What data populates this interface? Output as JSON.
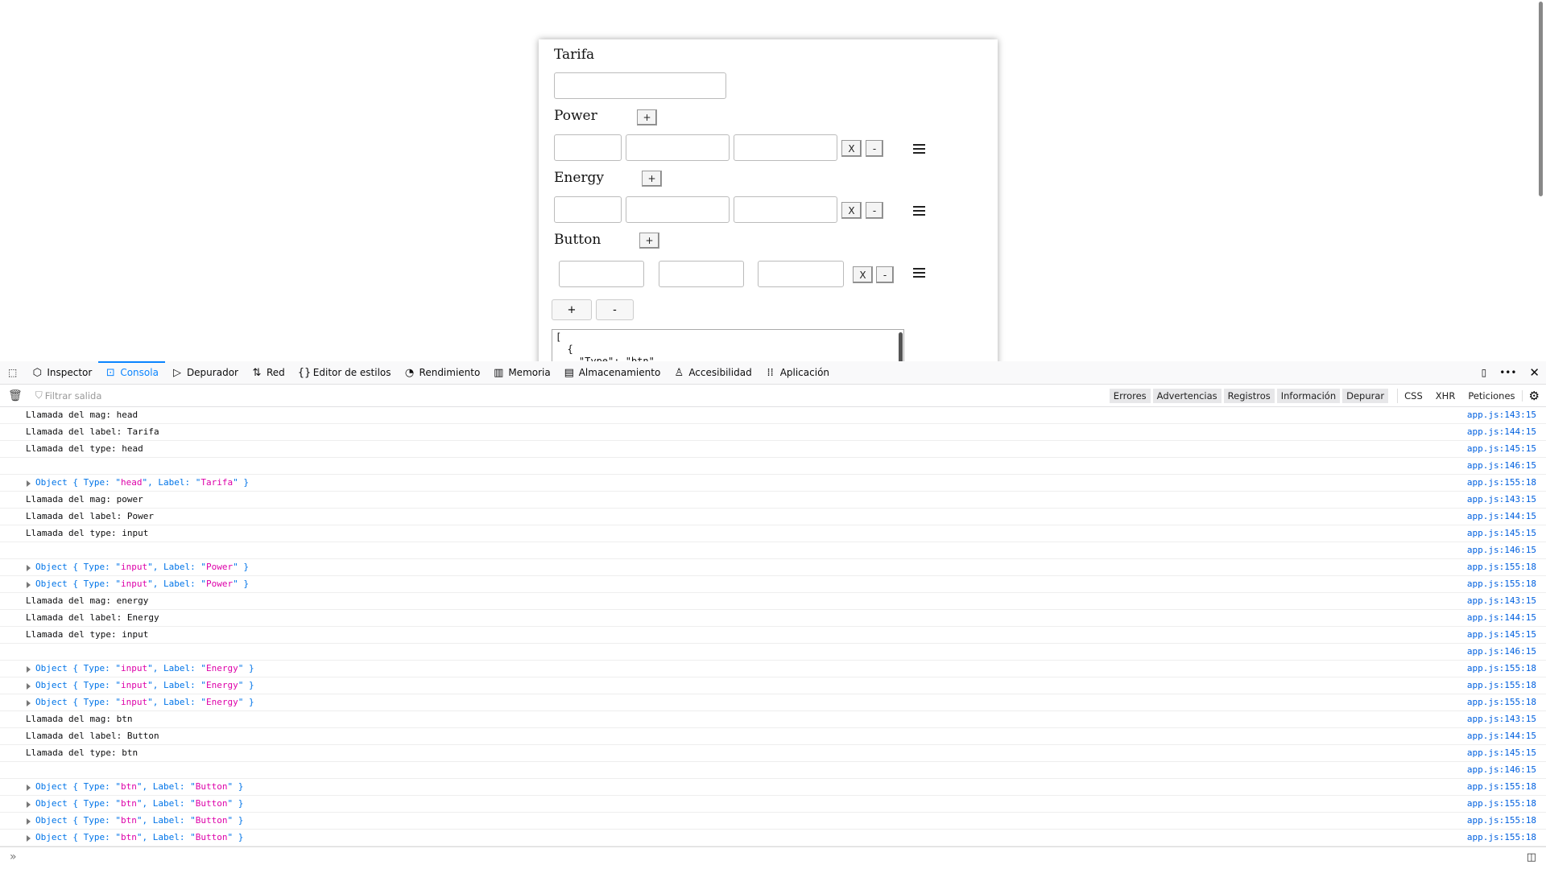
{
  "form": {
    "sections": [
      {
        "label": "Tarifa"
      },
      {
        "label": "Power",
        "add": "+",
        "remove_x": "X",
        "remove": "-"
      },
      {
        "label": "Energy",
        "add": "+",
        "remove_x": "X",
        "remove": "-"
      },
      {
        "label": "Button",
        "add": "+",
        "remove_x": "X",
        "remove": "-"
      }
    ],
    "add_section": "+",
    "remove_section": "-",
    "json_output": "[\n  {\n    \"Type\": \"btn\""
  },
  "devtools": {
    "tabs": [
      {
        "label": "Inspector",
        "icon": "inspector-icon",
        "glyph": "⬡"
      },
      {
        "label": "Consola",
        "icon": "console-icon",
        "glyph": "⊡",
        "selected": true
      },
      {
        "label": "Depurador",
        "icon": "debugger-icon",
        "glyph": "▷"
      },
      {
        "label": "Red",
        "icon": "network-icon",
        "glyph": "⇅"
      },
      {
        "label": "Editor de estilos",
        "icon": "style-editor-icon",
        "glyph": "{}"
      },
      {
        "label": "Rendimiento",
        "icon": "performance-icon",
        "glyph": "◔"
      },
      {
        "label": "Memoria",
        "icon": "memory-icon",
        "glyph": "▥"
      },
      {
        "label": "Almacenamiento",
        "icon": "storage-icon",
        "glyph": "▤"
      },
      {
        "label": "Accesibilidad",
        "icon": "accessibility-icon",
        "glyph": "♙"
      },
      {
        "label": "Aplicación",
        "icon": "application-icon",
        "glyph": "⁞⁞"
      }
    ],
    "filter_placeholder": "Filtrar salida",
    "levels": [
      "Errores",
      "Advertencias",
      "Registros",
      "Información",
      "Depurar"
    ],
    "types": [
      "CSS",
      "XHR",
      "Peticiones"
    ],
    "accent": "#0a84ff"
  },
  "console": [
    {
      "text": "Llamada del mag: head",
      "loc": "app.js:143:15"
    },
    {
      "text": "Llamada del label: Tarifa",
      "loc": "app.js:144:15"
    },
    {
      "text": "Llamada del type: head",
      "loc": "app.js:145:15"
    },
    {
      "text": "",
      "loc": "app.js:146:15"
    },
    {
      "type": "head",
      "label": "Tarifa",
      "loc": "app.js:155:18"
    },
    {
      "text": "Llamada del mag: power",
      "loc": "app.js:143:15"
    },
    {
      "text": "Llamada del label: Power",
      "loc": "app.js:144:15"
    },
    {
      "text": "Llamada del type: input",
      "loc": "app.js:145:15"
    },
    {
      "text": "",
      "loc": "app.js:146:15"
    },
    {
      "type": "input",
      "label": "Power",
      "loc": "app.js:155:18"
    },
    {
      "type": "input",
      "label": "Power",
      "loc": "app.js:155:18"
    },
    {
      "text": "Llamada del mag: energy",
      "loc": "app.js:143:15"
    },
    {
      "text": "Llamada del label: Energy",
      "loc": "app.js:144:15"
    },
    {
      "text": "Llamada del type: input",
      "loc": "app.js:145:15"
    },
    {
      "text": "",
      "loc": "app.js:146:15"
    },
    {
      "type": "input",
      "label": "Energy",
      "loc": "app.js:155:18"
    },
    {
      "type": "input",
      "label": "Energy",
      "loc": "app.js:155:18"
    },
    {
      "type": "input",
      "label": "Energy",
      "loc": "app.js:155:18"
    },
    {
      "text": "Llamada del mag: btn",
      "loc": "app.js:143:15"
    },
    {
      "text": "Llamada del label: Button",
      "loc": "app.js:144:15"
    },
    {
      "text": "Llamada del type: btn",
      "loc": "app.js:145:15"
    },
    {
      "text": "",
      "loc": "app.js:146:15"
    },
    {
      "type": "btn",
      "label": "Button",
      "loc": "app.js:155:18"
    },
    {
      "type": "btn",
      "label": "Button",
      "loc": "app.js:155:18"
    },
    {
      "type": "btn",
      "label": "Button",
      "loc": "app.js:155:18"
    },
    {
      "type": "btn",
      "label": "Button",
      "loc": "app.js:155:18"
    }
  ]
}
